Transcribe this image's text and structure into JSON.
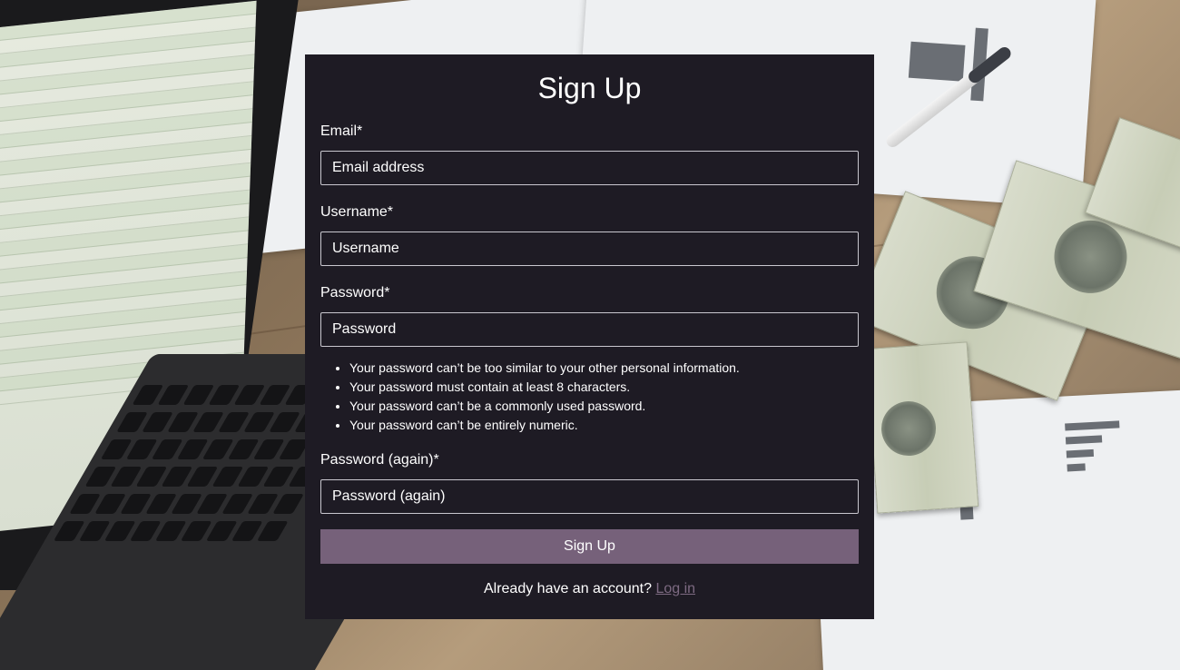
{
  "form": {
    "title": "Sign Up",
    "email": {
      "label": "Email*",
      "placeholder": "Email address",
      "value": ""
    },
    "username": {
      "label": "Username*",
      "placeholder": "Username",
      "value": ""
    },
    "password": {
      "label": "Password*",
      "placeholder": "Password",
      "value": "",
      "help": [
        "Your password can’t be too similar to your other personal information.",
        "Your password must contain at least 8 characters.",
        "Your password can’t be a commonly used password.",
        "Your password can’t be entirely numeric."
      ]
    },
    "password_again": {
      "label": "Password (again)*",
      "placeholder": "Password (again)",
      "value": ""
    },
    "submit_label": "Sign Up",
    "footer_text": "Already have an account?",
    "login_link": "Log in"
  },
  "colors": {
    "card_background": "#1e1b24",
    "button_background": "#76617a",
    "link_color": "#7d6a82",
    "text": "#ffffff"
  },
  "background": {
    "description_icons": [
      "laptop-icon",
      "money-icon",
      "pen-icon",
      "paper-icon"
    ]
  }
}
